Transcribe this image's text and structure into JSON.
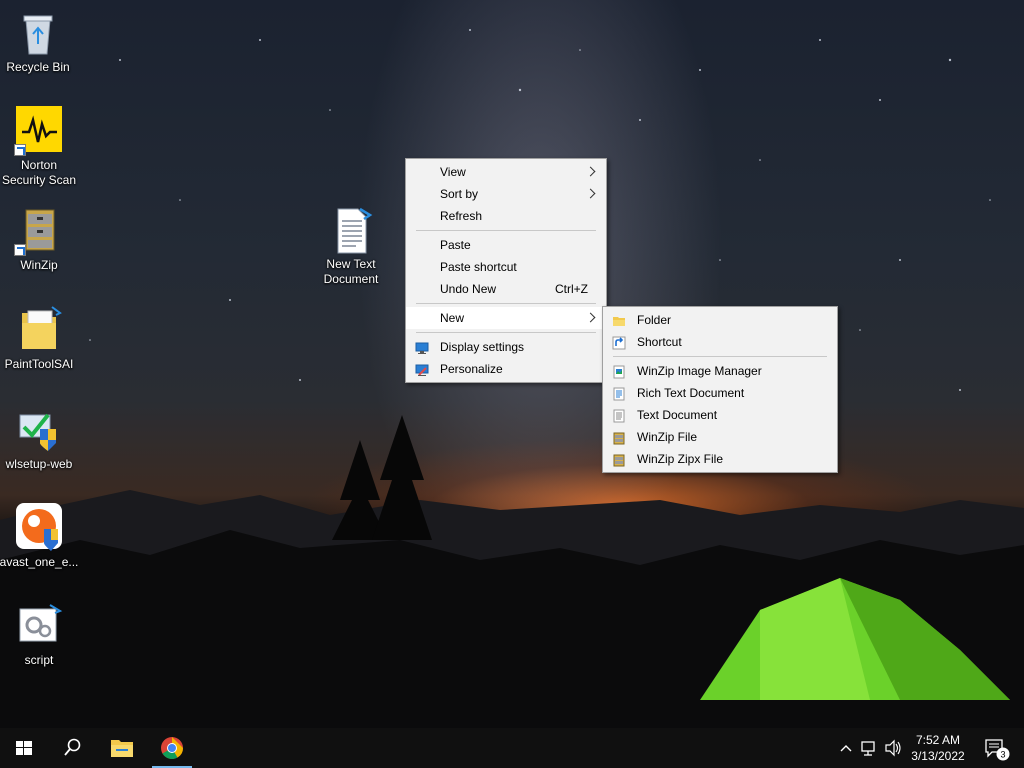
{
  "desktop": {
    "icons": [
      {
        "label": "Recycle Bin"
      },
      {
        "label": "Norton Security Scan"
      },
      {
        "label": "WinZip"
      },
      {
        "label": "PaintToolSAI"
      },
      {
        "label": "wlsetup-web"
      },
      {
        "label": "avast_one_e..."
      },
      {
        "label": "script"
      },
      {
        "label": "New Text Document"
      }
    ]
  },
  "context_menu": {
    "items": {
      "view": "View",
      "sort_by": "Sort by",
      "refresh": "Refresh",
      "paste": "Paste",
      "paste_shortcut": "Paste shortcut",
      "undo_new": "Undo New",
      "undo_new_accel": "Ctrl+Z",
      "new": "New",
      "display_settings": "Display settings",
      "personalize": "Personalize"
    }
  },
  "new_submenu": {
    "items": {
      "folder": "Folder",
      "shortcut": "Shortcut",
      "winzip_image_manager": "WinZip Image Manager",
      "rich_text_document": "Rich Text Document",
      "text_document": "Text Document",
      "winzip_file": "WinZip File",
      "winzip_zipx_file": "WinZip Zipx File"
    }
  },
  "taskbar": {
    "clock_time": "7:52 AM",
    "clock_date": "3/13/2022",
    "notification_count": "3"
  },
  "colors": {
    "accent": "#76b9ed",
    "menu_background": "#f2f2f2",
    "taskbar": "#101010"
  }
}
